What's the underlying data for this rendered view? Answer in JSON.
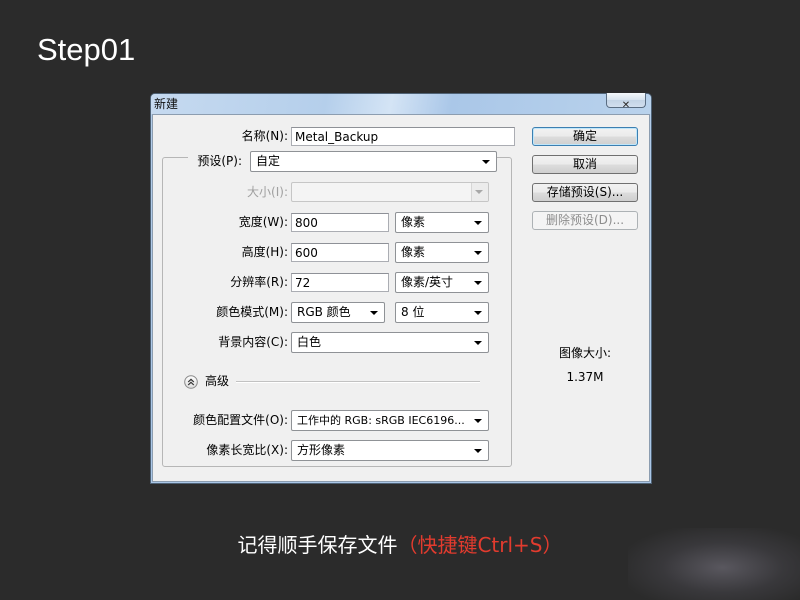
{
  "step_title": "Step01",
  "dialog": {
    "title": "新建",
    "close_icon": "close-icon",
    "fields": {
      "name": {
        "label": "名称(N):",
        "value": "Metal_Backup"
      },
      "preset": {
        "label": "预设(P):",
        "value": "自定"
      },
      "size": {
        "label": "大小(I):",
        "disabled": true
      },
      "width": {
        "label": "宽度(W):",
        "value": "800",
        "unit": "像素"
      },
      "height": {
        "label": "高度(H):",
        "value": "600",
        "unit": "像素"
      },
      "resolution": {
        "label": "分辨率(R):",
        "value": "72",
        "unit": "像素/英寸"
      },
      "color_mode": {
        "label": "颜色模式(M):",
        "value": "RGB 颜色",
        "bit_depth": "8 位"
      },
      "background_contents": {
        "label": "背景内容(C):",
        "value": "白色"
      },
      "color_profile": {
        "label": "颜色配置文件(O):",
        "value": "工作中的 RGB: sRGB IEC6196..."
      },
      "pixel_aspect_ratio": {
        "label": "像素长宽比(X):",
        "value": "方形像素"
      }
    },
    "advanced": {
      "label": "高级",
      "icon": "double-chevron-up-icon",
      "expanded": true
    },
    "buttons": {
      "ok": "确定",
      "cancel": "取消",
      "save_preset": "存储预设(S)...",
      "delete_preset": {
        "label": "删除预设(D)...",
        "disabled": true
      }
    },
    "image_size": {
      "label": "图像大小:",
      "value": "1.37M"
    }
  },
  "caption": {
    "text": "记得顺手保存文件",
    "shortcut_hint": "（快捷键Ctrl+S）"
  },
  "colors": {
    "page_background": "#2b2b2b",
    "caption_text": "#ffffff",
    "caption_highlight": "#e23b2e",
    "dialog_background": "#f0f0f0"
  },
  "icons": {
    "dropdown": "dropdown-arrow-icon"
  }
}
